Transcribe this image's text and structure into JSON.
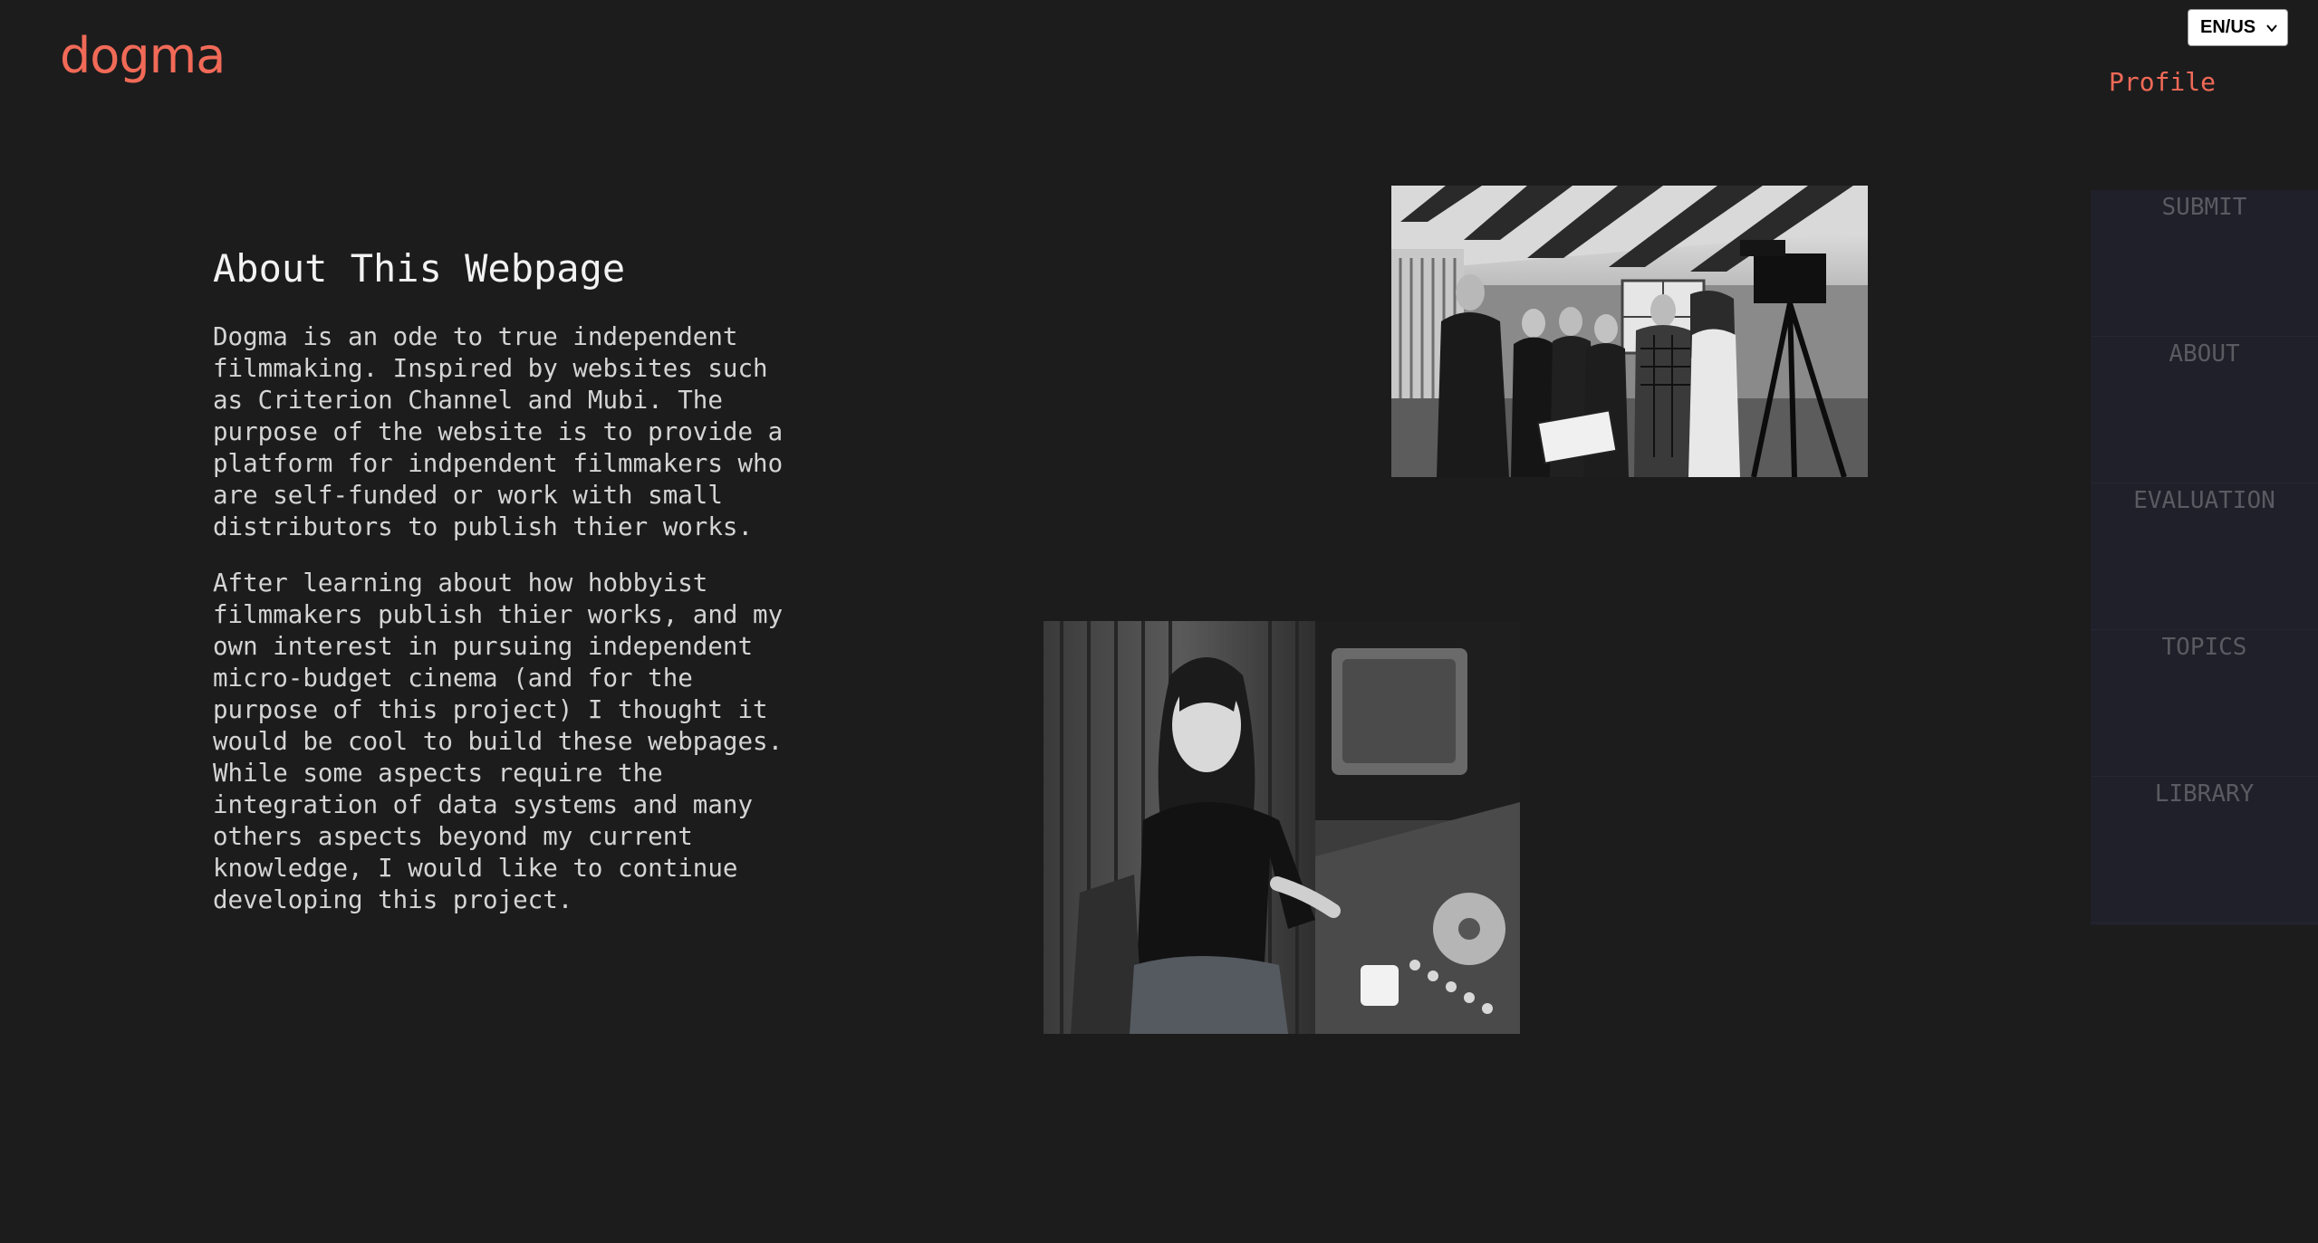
{
  "header": {
    "logo_text": "dogma",
    "language_selected": "EN/US",
    "profile_label": "Profile"
  },
  "side_nav": {
    "items": [
      {
        "label": "SUBMIT"
      },
      {
        "label": "ABOUT"
      },
      {
        "label": "EVALUATION"
      },
      {
        "label": "TOPICS"
      },
      {
        "label": "LIBRARY"
      }
    ]
  },
  "main": {
    "title": "About This Webpage",
    "paragraphs": [
      "Dogma is an ode to true independent\nfilmmaking. Inspired by websites such\nas Criterion Channel and Mubi. The\npurpose of the website is to provide a\nplatform for indpendent filmmakers who\nare self-funded or work with small\ndistributors to publish thier works.",
      "After learning about how hobbyist\nfilmmakers publish thier works, and my\nown interest in pursuing independent\nmicro-budget cinema (and for the\npurpose of this project) I thought it\nwould be cool to build these webpages.\nWhile some aspects require the\nintegration of data systems and many\nothers aspects beyond my current\nknowledge, I would like to continue\ndeveloping this project."
    ]
  },
  "colors": {
    "background": "#1c1c1d",
    "accent": "#f16a57",
    "nav_background": "#1f2029",
    "nav_text": "#5a5b62"
  },
  "icons": {
    "language_dropdown": "chevron-down-icon"
  }
}
